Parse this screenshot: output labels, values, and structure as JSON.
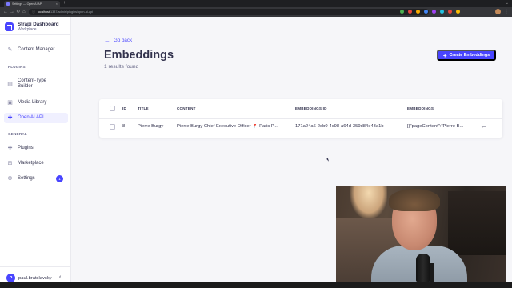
{
  "browser": {
    "tab_title": "Settings — Open AI API",
    "tab_close": "×",
    "new_tab": "+",
    "url_host": "localhost",
    "url_path": ":1337/admin/plugins/open-ai-api",
    "back": "←",
    "forward": "→",
    "reload": "↻",
    "home": "⌂",
    "window_controls": "⌄",
    "menu": "⋮",
    "extension_colors": [
      "#4caf50",
      "#e8453c",
      "#f9ab00",
      "#4285f4",
      "#a142f4",
      "#24c1e0",
      "#e8453c",
      "#fbbc04"
    ]
  },
  "sidebar": {
    "brand_title": "Strapi Dashboard",
    "brand_subtitle": "Workplace",
    "content_manager": "Content Manager",
    "plugins_heading": "PLUGINS",
    "plugins": [
      {
        "label": "Content-Type",
        "label2": "Builder",
        "icon": "layout-icon"
      },
      {
        "label": "Media Library",
        "icon": "image-icon"
      },
      {
        "label": "Open AI API",
        "icon": "puzzle-icon",
        "active": true
      }
    ],
    "general_heading": "GENERAL",
    "general": [
      {
        "label": "Plugins",
        "icon": "puzzle-icon"
      },
      {
        "label": "Marketplace",
        "icon": "cart-icon"
      },
      {
        "label": "Settings",
        "icon": "gear-icon",
        "badge": "1"
      }
    ],
    "user_initial": "P",
    "user_name": "paul.bratslavsky",
    "collapse": "‹"
  },
  "main": {
    "back_label": "Go back",
    "title": "Embeddings",
    "subtitle": "1 results found",
    "create_button": "Create Embeddings",
    "table": {
      "headers": [
        "ID",
        "TITLE",
        "CONTENT",
        "EMBEDDINGS ID",
        "EMBEDDINGS"
      ],
      "rows": [
        {
          "id": "8",
          "title": "Pierre Burgy",
          "content": "Pierre Burgy Chief Executive Officer 📍 Paris P...",
          "embeddings_id": "171a24a6-2db0-4c98-a64d-359d84e43a1b",
          "embeddings": "[{\"pageContent\":\"Pierre B..."
        }
      ]
    }
  }
}
